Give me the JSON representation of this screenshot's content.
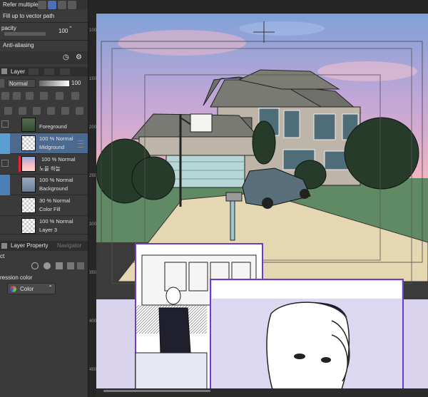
{
  "tool_property": {
    "refer_multiple_label": "Refer multiple",
    "fill_vector_label": "Fill up to vector path",
    "opacity_label": "pacity",
    "opacity_value": "100",
    "antialias_label": "Anti-aliasing"
  },
  "layer_panel": {
    "tab_label": "Layer",
    "blend_mode": "Normal",
    "opacity_value": "100",
    "layers": [
      {
        "opacity_mode": "",
        "name": "Foreground"
      },
      {
        "opacity_mode": "100 % Normal",
        "name": "Midground"
      },
      {
        "opacity_mode": "100 % Normal",
        "name": "노을 하늘"
      },
      {
        "opacity_mode": "100 % Normal",
        "name": "Background"
      },
      {
        "opacity_mode": "30 % Normal",
        "name": "Color Fill"
      },
      {
        "opacity_mode": "100 % Normal",
        "name": "Layer 3"
      }
    ]
  },
  "layer_property": {
    "tab_label": "Layer Property",
    "tab2_label": "Navigator",
    "effect_label": "ct",
    "expression_label": "ression color",
    "expression_value": "Color"
  },
  "ruler": {
    "ticks": [
      "100",
      "150",
      "200",
      "250",
      "300",
      "350",
      "400",
      "450"
    ]
  },
  "colors": {
    "panel_bg": "#3a3a3a",
    "selected_row": "#4c6a90",
    "accent": "#5a9fd4",
    "frame_purple": "#6a3ec8"
  }
}
